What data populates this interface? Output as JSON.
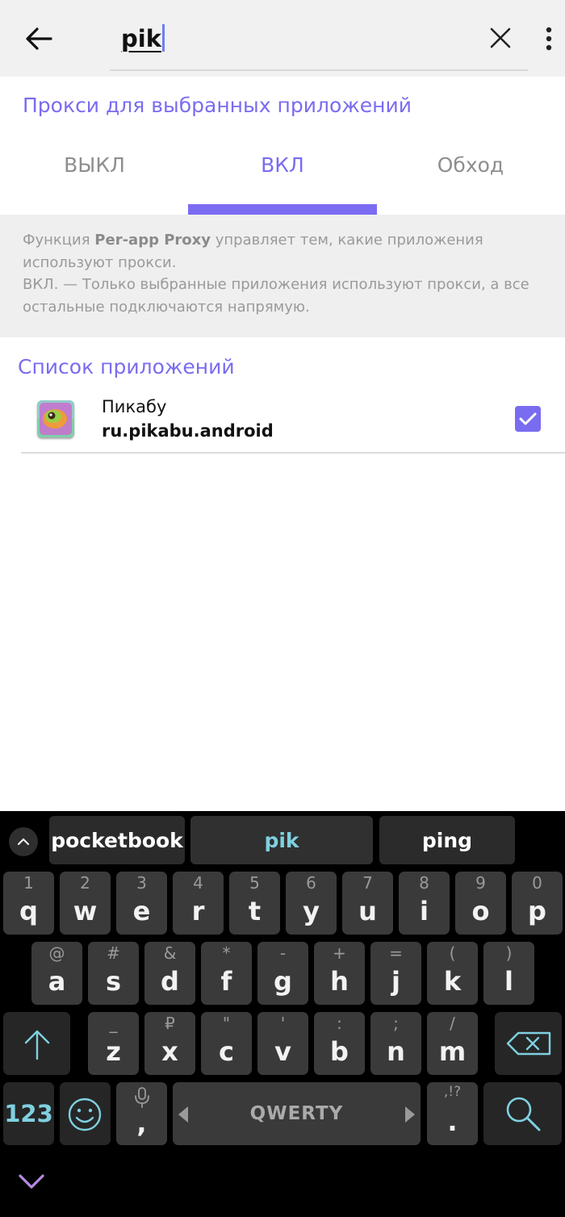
{
  "search": {
    "query": "pik"
  },
  "proxy": {
    "title": "Прокси для выбранных приложений",
    "tabs": [
      {
        "label": "ВЫКЛ",
        "active": false
      },
      {
        "label": "ВКЛ",
        "active": true
      },
      {
        "label": "Обход",
        "active": false
      }
    ],
    "info": {
      "prefix": "Функция ",
      "feature_name": "Per-app Proxy",
      "suffix": " управляет тем, какие приложения используют прокси.",
      "on_desc": "ВКЛ. — Только выбранные приложения используют прокси, а все остальные подключаются напрямую."
    }
  },
  "apps": {
    "title": "Список приложений",
    "items": [
      {
        "name": "Пикабу",
        "package": "ru.pikabu.android",
        "checked": true,
        "icon": "pikabu-app-icon"
      }
    ]
  },
  "keyboard": {
    "suggestions": [
      "pocketbook",
      "pik",
      "ping"
    ],
    "row1": [
      {
        "hint": "1",
        "key": "q"
      },
      {
        "hint": "2",
        "key": "w"
      },
      {
        "hint": "3",
        "key": "e"
      },
      {
        "hint": "4",
        "key": "r"
      },
      {
        "hint": "5",
        "key": "t"
      },
      {
        "hint": "6",
        "key": "y"
      },
      {
        "hint": "7",
        "key": "u"
      },
      {
        "hint": "8",
        "key": "i"
      },
      {
        "hint": "9",
        "key": "o"
      },
      {
        "hint": "0",
        "key": "p"
      }
    ],
    "row2": [
      {
        "hint": "@",
        "key": "a"
      },
      {
        "hint": "#",
        "key": "s"
      },
      {
        "hint": "&",
        "key": "d"
      },
      {
        "hint": "*",
        "key": "f"
      },
      {
        "hint": "-",
        "key": "g"
      },
      {
        "hint": "+",
        "key": "h"
      },
      {
        "hint": "=",
        "key": "j"
      },
      {
        "hint": "(",
        "key": "k"
      },
      {
        "hint": ")",
        "key": "l"
      }
    ],
    "row3": [
      {
        "hint": "_",
        "key": "z"
      },
      {
        "hint": "₽",
        "key": "x"
      },
      {
        "hint": "\"",
        "key": "c"
      },
      {
        "hint": "'",
        "key": "v"
      },
      {
        "hint": ":",
        "key": "b"
      },
      {
        "hint": ";",
        "key": "n"
      },
      {
        "hint": "/",
        "key": "m"
      }
    ],
    "numbers_label": "123",
    "comma": ",",
    "space_label": "QWERTY",
    "period_hint": ",!?",
    "period": "."
  },
  "colors": {
    "accent": "#7a6cf0",
    "cyan": "#7fd0e0"
  }
}
